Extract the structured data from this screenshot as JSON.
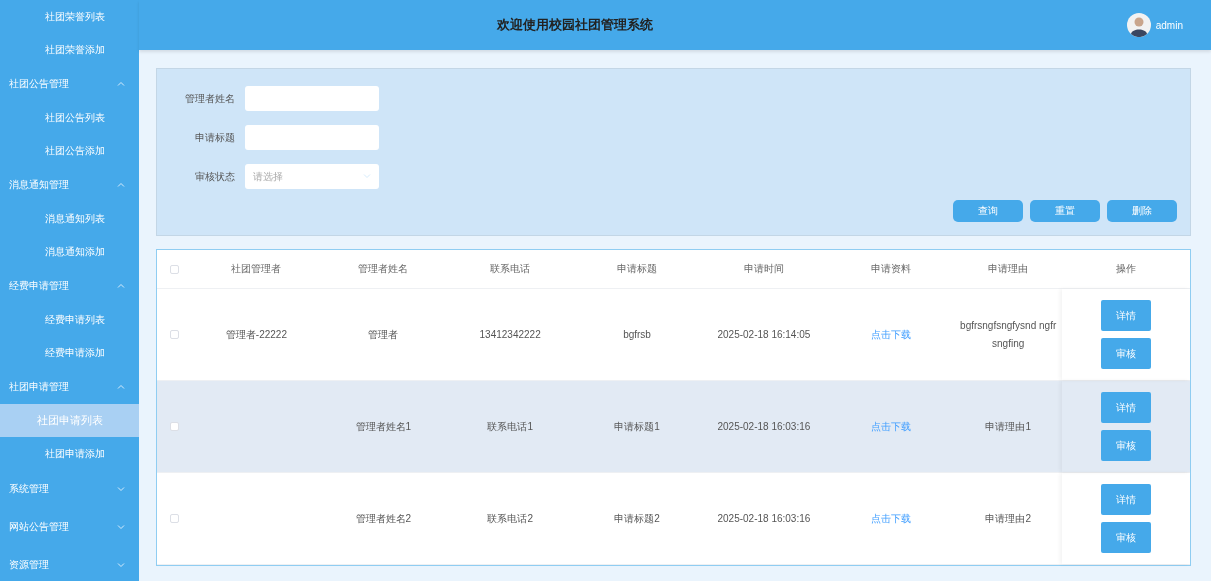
{
  "header": {
    "title": "欢迎使用校园社团管理系统",
    "user": "admin"
  },
  "sidebar": {
    "items": [
      {
        "children": [
          {
            "label": "社团荣誉列表",
            "selected": false
          },
          {
            "label": "社团荣誉添加",
            "selected": false
          }
        ]
      },
      {
        "label": "社团公告管理",
        "expanded": true,
        "children": [
          {
            "label": "社团公告列表",
            "selected": false
          },
          {
            "label": "社团公告添加",
            "selected": false
          }
        ]
      },
      {
        "label": "消息通知管理",
        "expanded": true,
        "children": [
          {
            "label": "消息通知列表",
            "selected": false
          },
          {
            "label": "消息通知添加",
            "selected": false
          }
        ]
      },
      {
        "label": "经费申请管理",
        "expanded": true,
        "children": [
          {
            "label": "经费申请列表",
            "selected": false
          },
          {
            "label": "经费申请添加",
            "selected": false
          }
        ]
      },
      {
        "label": "社团申请管理",
        "expanded": true,
        "children": [
          {
            "label": "社团申请列表",
            "selected": true
          },
          {
            "label": "社团申请添加",
            "selected": false
          }
        ]
      },
      {
        "label": "系统管理",
        "expanded": false
      },
      {
        "label": "网站公告管理",
        "expanded": false
      },
      {
        "label": "资源管理",
        "expanded": false
      }
    ]
  },
  "filters": {
    "fields": [
      {
        "label": "管理者姓名",
        "kind": "text"
      },
      {
        "label": "申请标题",
        "kind": "text"
      },
      {
        "label": "审核状态",
        "kind": "select",
        "placeholder": "请选择"
      }
    ],
    "buttons": [
      "查询",
      "重置",
      "删除"
    ]
  },
  "table": {
    "all_checked": false,
    "columns": [
      {
        "label": "社团管理者",
        "kind": "text"
      },
      {
        "label": "管理者姓名",
        "kind": "text"
      },
      {
        "label": "联系电话",
        "kind": "text"
      },
      {
        "label": "申请标题",
        "kind": "text"
      },
      {
        "label": "申请时间",
        "kind": "text"
      },
      {
        "label": "申请资料",
        "kind": "link"
      },
      {
        "label": "申请理由",
        "kind": "text"
      }
    ],
    "actions_label": "操作",
    "rows": [
      {
        "checked": false,
        "highlighted": false,
        "cells": [
          "管理者-22222",
          "管理者",
          "13412342222",
          "bgfrsb",
          "2025-02-18 16:14:05",
          "点击下载",
          "bgfrsngfsngfysnd ngfrsngfing"
        ],
        "actions": [
          "详情",
          "审核"
        ]
      },
      {
        "checked": false,
        "highlighted": true,
        "cells": [
          "",
          "管理者姓名1",
          "联系电话1",
          "申请标题1",
          "2025-02-18 16:03:16",
          "点击下载",
          "申请理由1"
        ],
        "actions": [
          "详情",
          "审核"
        ]
      },
      {
        "checked": false,
        "highlighted": false,
        "cells": [
          "",
          "管理者姓名2",
          "联系电话2",
          "申请标题2",
          "2025-02-18 16:03:16",
          "点击下载",
          "申请理由2"
        ],
        "actions": [
          "详情",
          "审核"
        ]
      }
    ]
  }
}
